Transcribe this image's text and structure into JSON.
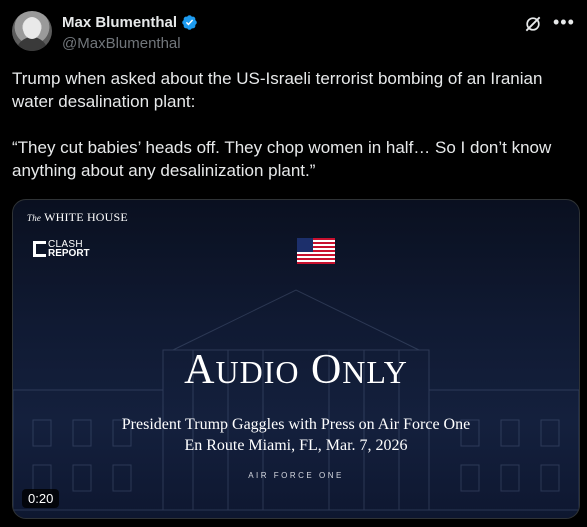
{
  "author": {
    "display_name": "Max Blumenthal",
    "handle": "@MaxBlumenthal",
    "verified": true
  },
  "tweet": {
    "paragraphs": [
      "Trump when asked about the US-Israeli terrorist bombing of an Iranian water desalination plant:",
      "“They cut babies’ heads off. They chop women in half… So I don’t know anything about any desalinization plant.”"
    ]
  },
  "media": {
    "logo_the": "The",
    "logo_wh": "WHITE HOUSE",
    "clash_line1": "CLASH",
    "clash_line2": "REPORT",
    "title_first_big": "A",
    "title_first_small": "UDIO",
    "title_second_big": "O",
    "title_second_small": "NLY",
    "subtitle_line1": "President Trump Gaggles with Press on Air Force One",
    "subtitle_line2": "En Route Miami, FL, Mar. 7, 2026",
    "footer": "AIR FORCE ONE",
    "duration": "0:20"
  },
  "icons": {
    "verified": "verified-badge-icon",
    "grok": "grok-icon",
    "more": "more-icon",
    "flag": "us-flag-icon"
  },
  "colors": {
    "background": "#000000",
    "text": "#e7e9ea",
    "muted": "#71767b",
    "verified": "#1d9bf0"
  }
}
